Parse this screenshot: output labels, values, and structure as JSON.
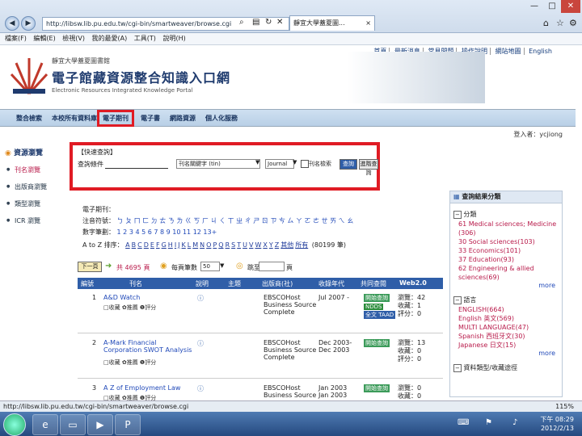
{
  "browser": {
    "url": "http://libsw.lib.pu.edu.tw/cgi-bin/smartweaver/browse.cgi",
    "tab_title": "靜宜大學蓋夏圖...",
    "tab_close": "×",
    "menu": [
      "檔案(F)",
      "編輯(E)",
      "檢視(V)",
      "我的最愛(A)",
      "工具(T)",
      "說明(H)"
    ],
    "status_url": "http://libsw.lib.pu.edu.tw/cgi-bin/smartweaver/browse.cgi",
    "zoom": "115%",
    "win_min": "—",
    "win_max": "□",
    "win_close": "✕"
  },
  "header": {
    "top_links": [
      "首頁",
      "最新消息",
      "常見問題",
      "操作說明",
      "網站地圖",
      "English"
    ],
    "library_name": "靜宜大學蓋夏圖書館",
    "portal_title": "電子館藏資源整合知識入口網",
    "portal_subtitle": "Electronic Resources Integrated Knowledge Portal",
    "nav": [
      "整合檢索",
      "本校所有資料庫",
      "電子期刊",
      "電子書",
      "網路資源",
      "個人化服務"
    ],
    "login_label": "登入者：",
    "login_user": "ycjiong"
  },
  "sidebar": {
    "title": "資源瀏覽",
    "items": [
      "刊名瀏覽",
      "出版商瀏覽",
      "類型瀏覽",
      "ICR 瀏覽"
    ]
  },
  "search": {
    "title": "【快速查詢】",
    "label": "查詢條件",
    "field_value": "刊名關鍵字 (tin)",
    "type_value": "Journal",
    "checkbox_label": "刊名檢索",
    "go_label": "查詢",
    "advanced_label": "進階查詢"
  },
  "browse": {
    "heading": "電子期刊：",
    "subject_label": "注音符號：",
    "subject_chars": "ㄅ ㄆ ㄇ ㄈ ㄉ ㄊ ㄋ ㄌ ㄍ ㄎ ㄏ ㄐ ㄑ ㄒ ㄓ ㄔ ㄕ ㄖ ㄗ ㄘ ㄙ ㄚ ㄛ ㄜ ㄝ ㄞ ㄟ ㄠ",
    "number_label": "數字筆劃：",
    "numbers": "1 2 3 4 5 6 7 8 9 10 11 12 13+",
    "az_label": "A to Z 排序：",
    "letters": [
      "A",
      "B",
      "C",
      "D",
      "E",
      "F",
      "G",
      "H",
      "I",
      "J",
      "K",
      "L",
      "M",
      "N",
      "O",
      "P",
      "Q",
      "R",
      "S",
      "T",
      "U",
      "V",
      "W",
      "X",
      "Y",
      "Z",
      "其他",
      "所有"
    ],
    "total": "(80199 筆)",
    "next_page": "下一頁",
    "page_total": "共 4695 頁",
    "per_page_label": "每頁筆數",
    "per_page_value": "50",
    "goto_label": "跳至",
    "goto_unit": "頁"
  },
  "table": {
    "headers": [
      "編號",
      "刊名",
      "說明",
      "主題",
      "出版商(社)",
      "收錄年代",
      "共同查閱",
      "Web2.0"
    ],
    "rows": [
      {
        "num": "1",
        "title": "A&D Watch",
        "tools": "□收藏 ✿推薦 ❶評分",
        "info": "ⓘ",
        "publisher": "EBSCOHost Business Source Complete",
        "years": "Jul 2007 -",
        "tag1": "開始查詢",
        "tag2": "NDDS",
        "tag3": "全文 TAAD",
        "stat1": "瀏覽：42",
        "stat2": "收藏：1",
        "stat3": "評分：0"
      },
      {
        "num": "2",
        "title": "A-Mark Financial Corporation SWOT Analysis",
        "tools": "□收藏 ✿推薦 ❶評分",
        "info": "ⓘ",
        "publisher": "EBSCOHost Business Source Complete",
        "years": "Dec 2003- Dec 2003",
        "tag1": "開始查詢",
        "tag2": "",
        "tag3": "",
        "stat1": "瀏覽：13",
        "stat2": "收藏：0",
        "stat3": "評分：0"
      },
      {
        "num": "3",
        "title": "A Z of Employment Law",
        "tools": "□收藏 ✿推薦 ❶評分",
        "info": "ⓘ",
        "publisher": "EBSCOHost Business Source",
        "years": "Jan 2003 Jan 2003",
        "tag1": "開始查詢",
        "tag2": "",
        "tag3": "",
        "stat1": "瀏覽：0",
        "stat2": "收藏：0",
        "stat3": ""
      }
    ]
  },
  "facets": {
    "title": "查詢結果分類",
    "groups": [
      {
        "name": "分類",
        "items": [
          "61 Medical sciences; Medicine (306)",
          "30 Social sciences(103)",
          "33 Economics(101)",
          "37 Education(93)",
          "62 Engineering & allied sciences(69)"
        ],
        "more": "more"
      },
      {
        "name": "語言",
        "items": [
          "ENGLISH(664)",
          "English 英文(569)",
          "MULTI LANGUAGE(47)",
          "Spanish 西班牙文(30)",
          "Japanese 日文(15)"
        ],
        "more": "more"
      },
      {
        "name": "資料類型/收藏途徑",
        "items": [],
        "more": ""
      }
    ]
  },
  "taskbar": {
    "clock_time": "下午 08:29",
    "clock_date": "2012/2/13"
  }
}
